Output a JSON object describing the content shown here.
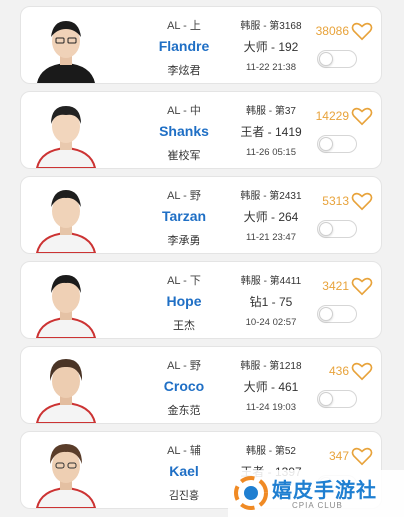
{
  "players": [
    {
      "team_pos": "AL - 上",
      "nick": "Flandre",
      "realname": "李炫君",
      "server": "韩服 - 第3168",
      "rank": "大师 - 192",
      "time": "11-22 21:38",
      "likes": "38086",
      "toggle": "off"
    },
    {
      "team_pos": "AL - 中",
      "nick": "Shanks",
      "realname": "崔校军",
      "server": "韩服 - 第37",
      "rank": "王者 - 1419",
      "time": "11-26 05:15",
      "likes": "14229",
      "toggle": "off"
    },
    {
      "team_pos": "AL - 野",
      "nick": "Tarzan",
      "realname": "李承勇",
      "server": "韩服 - 第2431",
      "rank": "大师 - 264",
      "time": "11-21 23:47",
      "likes": "5313",
      "toggle": "off"
    },
    {
      "team_pos": "AL - 下",
      "nick": "Hope",
      "realname": "王杰",
      "server": "韩服 - 第4411",
      "rank": "钻1 - 75",
      "time": "10-24 02:57",
      "likes": "3421",
      "toggle": "off"
    },
    {
      "team_pos": "AL - 野",
      "nick": "Croco",
      "realname": "金东范",
      "server": "韩服 - 第1218",
      "rank": "大师 - 461",
      "time": "11-24 19:03",
      "likes": "436",
      "toggle": "off"
    },
    {
      "team_pos": "AL - 辅",
      "nick": "Kael",
      "realname": "김진홍",
      "server": "韩服 - 第52",
      "rank": "王者 - 1397",
      "time": "",
      "likes": "347",
      "toggle": "off"
    }
  ],
  "watermark": {
    "title": "嬉皮手游社",
    "subtitle": "CPIA CLUB"
  },
  "colors": {
    "nick": "#1f6fc5",
    "likes": "#e8a33b",
    "heart": "#e8a33b",
    "card_bg": "#ffffff",
    "page_bg": "#f2f2f2"
  },
  "icons": {
    "heart": "heart-icon",
    "toggle": "switch-toggle",
    "avatar": "player-avatar"
  }
}
